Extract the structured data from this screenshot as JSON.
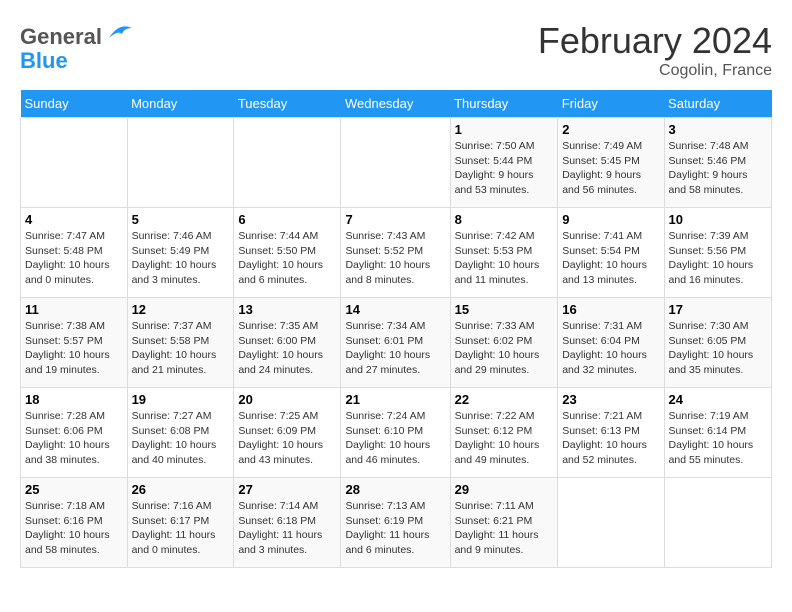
{
  "header": {
    "logo_line1": "General",
    "logo_line2": "Blue",
    "month": "February 2024",
    "location": "Cogolin, France"
  },
  "days_of_week": [
    "Sunday",
    "Monday",
    "Tuesday",
    "Wednesday",
    "Thursday",
    "Friday",
    "Saturday"
  ],
  "weeks": [
    [
      {
        "day": "",
        "info": ""
      },
      {
        "day": "",
        "info": ""
      },
      {
        "day": "",
        "info": ""
      },
      {
        "day": "",
        "info": ""
      },
      {
        "day": "1",
        "info": "Sunrise: 7:50 AM\nSunset: 5:44 PM\nDaylight: 9 hours\nand 53 minutes."
      },
      {
        "day": "2",
        "info": "Sunrise: 7:49 AM\nSunset: 5:45 PM\nDaylight: 9 hours\nand 56 minutes."
      },
      {
        "day": "3",
        "info": "Sunrise: 7:48 AM\nSunset: 5:46 PM\nDaylight: 9 hours\nand 58 minutes."
      }
    ],
    [
      {
        "day": "4",
        "info": "Sunrise: 7:47 AM\nSunset: 5:48 PM\nDaylight: 10 hours\nand 0 minutes."
      },
      {
        "day": "5",
        "info": "Sunrise: 7:46 AM\nSunset: 5:49 PM\nDaylight: 10 hours\nand 3 minutes."
      },
      {
        "day": "6",
        "info": "Sunrise: 7:44 AM\nSunset: 5:50 PM\nDaylight: 10 hours\nand 6 minutes."
      },
      {
        "day": "7",
        "info": "Sunrise: 7:43 AM\nSunset: 5:52 PM\nDaylight: 10 hours\nand 8 minutes."
      },
      {
        "day": "8",
        "info": "Sunrise: 7:42 AM\nSunset: 5:53 PM\nDaylight: 10 hours\nand 11 minutes."
      },
      {
        "day": "9",
        "info": "Sunrise: 7:41 AM\nSunset: 5:54 PM\nDaylight: 10 hours\nand 13 minutes."
      },
      {
        "day": "10",
        "info": "Sunrise: 7:39 AM\nSunset: 5:56 PM\nDaylight: 10 hours\nand 16 minutes."
      }
    ],
    [
      {
        "day": "11",
        "info": "Sunrise: 7:38 AM\nSunset: 5:57 PM\nDaylight: 10 hours\nand 19 minutes."
      },
      {
        "day": "12",
        "info": "Sunrise: 7:37 AM\nSunset: 5:58 PM\nDaylight: 10 hours\nand 21 minutes."
      },
      {
        "day": "13",
        "info": "Sunrise: 7:35 AM\nSunset: 6:00 PM\nDaylight: 10 hours\nand 24 minutes."
      },
      {
        "day": "14",
        "info": "Sunrise: 7:34 AM\nSunset: 6:01 PM\nDaylight: 10 hours\nand 27 minutes."
      },
      {
        "day": "15",
        "info": "Sunrise: 7:33 AM\nSunset: 6:02 PM\nDaylight: 10 hours\nand 29 minutes."
      },
      {
        "day": "16",
        "info": "Sunrise: 7:31 AM\nSunset: 6:04 PM\nDaylight: 10 hours\nand 32 minutes."
      },
      {
        "day": "17",
        "info": "Sunrise: 7:30 AM\nSunset: 6:05 PM\nDaylight: 10 hours\nand 35 minutes."
      }
    ],
    [
      {
        "day": "18",
        "info": "Sunrise: 7:28 AM\nSunset: 6:06 PM\nDaylight: 10 hours\nand 38 minutes."
      },
      {
        "day": "19",
        "info": "Sunrise: 7:27 AM\nSunset: 6:08 PM\nDaylight: 10 hours\nand 40 minutes."
      },
      {
        "day": "20",
        "info": "Sunrise: 7:25 AM\nSunset: 6:09 PM\nDaylight: 10 hours\nand 43 minutes."
      },
      {
        "day": "21",
        "info": "Sunrise: 7:24 AM\nSunset: 6:10 PM\nDaylight: 10 hours\nand 46 minutes."
      },
      {
        "day": "22",
        "info": "Sunrise: 7:22 AM\nSunset: 6:12 PM\nDaylight: 10 hours\nand 49 minutes."
      },
      {
        "day": "23",
        "info": "Sunrise: 7:21 AM\nSunset: 6:13 PM\nDaylight: 10 hours\nand 52 minutes."
      },
      {
        "day": "24",
        "info": "Sunrise: 7:19 AM\nSunset: 6:14 PM\nDaylight: 10 hours\nand 55 minutes."
      }
    ],
    [
      {
        "day": "25",
        "info": "Sunrise: 7:18 AM\nSunset: 6:16 PM\nDaylight: 10 hours\nand 58 minutes."
      },
      {
        "day": "26",
        "info": "Sunrise: 7:16 AM\nSunset: 6:17 PM\nDaylight: 11 hours\nand 0 minutes."
      },
      {
        "day": "27",
        "info": "Sunrise: 7:14 AM\nSunset: 6:18 PM\nDaylight: 11 hours\nand 3 minutes."
      },
      {
        "day": "28",
        "info": "Sunrise: 7:13 AM\nSunset: 6:19 PM\nDaylight: 11 hours\nand 6 minutes."
      },
      {
        "day": "29",
        "info": "Sunrise: 7:11 AM\nSunset: 6:21 PM\nDaylight: 11 hours\nand 9 minutes."
      },
      {
        "day": "",
        "info": ""
      },
      {
        "day": "",
        "info": ""
      }
    ]
  ]
}
